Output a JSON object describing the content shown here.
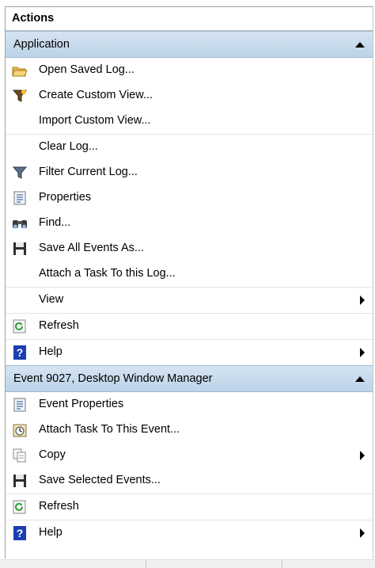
{
  "panel": {
    "title": "Actions"
  },
  "sections": [
    {
      "title": "Application",
      "items": [
        {
          "label": "Open Saved Log...",
          "icon": "open-folder-icon"
        },
        {
          "label": "Create Custom View...",
          "icon": "create-filter-icon"
        },
        {
          "label": "Import Custom View...",
          "icon": ""
        },
        {
          "label": "Clear Log...",
          "icon": ""
        },
        {
          "label": "Filter Current Log...",
          "icon": "filter-icon"
        },
        {
          "label": "Properties",
          "icon": "properties-icon"
        },
        {
          "label": "Find...",
          "icon": "binoculars-icon"
        },
        {
          "label": "Save All Events As...",
          "icon": "save-disk-icon"
        },
        {
          "label": "Attach a Task To this Log...",
          "icon": ""
        },
        {
          "label": "View",
          "icon": "",
          "submenu": true
        },
        {
          "label": "Refresh",
          "icon": "refresh-icon"
        },
        {
          "label": "Help",
          "icon": "help-icon",
          "submenu": true
        }
      ]
    },
    {
      "title": "Event 9027, Desktop Window Manager",
      "items": [
        {
          "label": "Event Properties",
          "icon": "properties-icon"
        },
        {
          "label": "Attach Task To This Event...",
          "icon": "task-clock-icon"
        },
        {
          "label": "Copy",
          "icon": "copy-icon",
          "submenu": true
        },
        {
          "label": "Save Selected Events...",
          "icon": "save-disk-icon"
        },
        {
          "label": "Refresh",
          "icon": "refresh-icon"
        },
        {
          "label": "Help",
          "icon": "help-icon",
          "submenu": true
        }
      ]
    }
  ],
  "colors": {
    "section_header": "#c5d9ec",
    "help_blue": "#1a3fb0",
    "refresh_green": "#2e9e3a",
    "folder_yellow": "#e8b84a"
  }
}
